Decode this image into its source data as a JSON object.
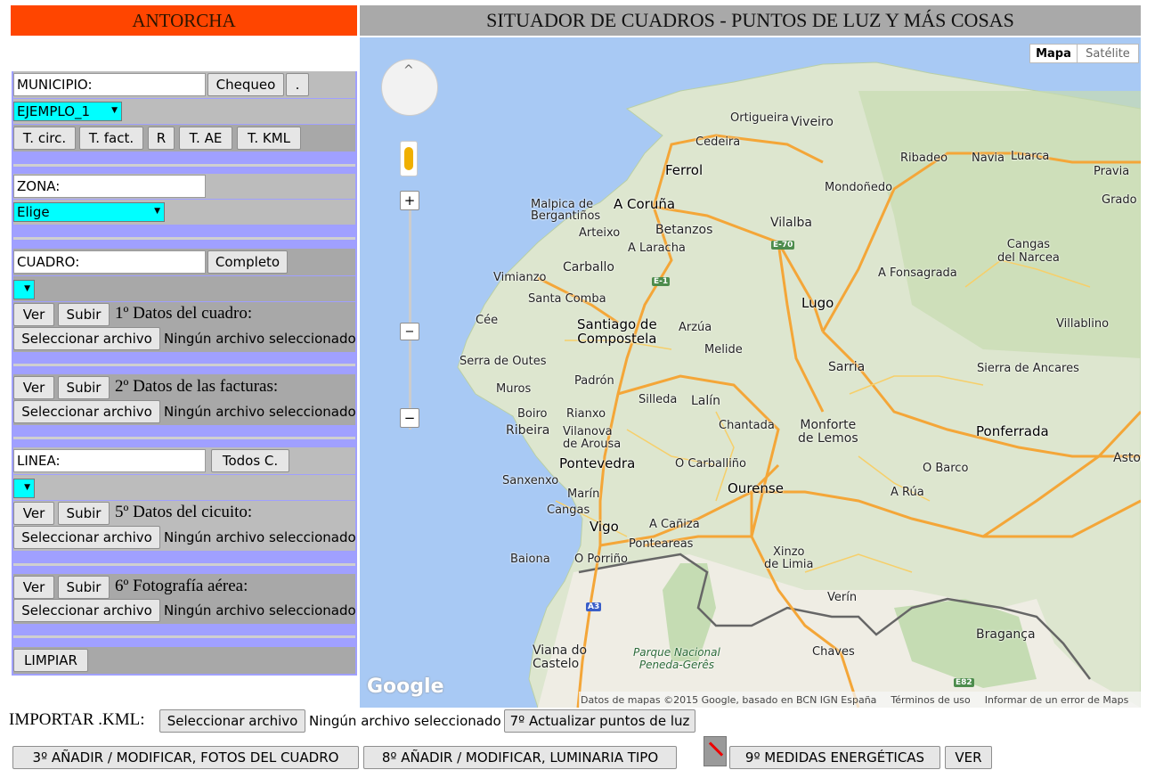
{
  "header": {
    "brand": "ANTORCHA",
    "title": "SITUADOR DE CUADROS - PUNTOS DE LUZ Y MÁS COSAS"
  },
  "colors": {
    "brand_bg": "#ff4500",
    "title_bg": "#a9a9a9",
    "panel_bg": "#a0a0ff",
    "select_bg": "#00ffff",
    "map_water": "#a8c9f4"
  },
  "panel": {
    "municipio": {
      "value": "MUNICIPIO:",
      "check_label": "Chequeo",
      "dot_label": ".",
      "select_value": "EJEMPLO_1"
    },
    "tools": [
      "T. circ.",
      "T. fact.",
      "R",
      "T. AE",
      "T. KML"
    ],
    "zona": {
      "value": "ZONA:",
      "select_value": "Elige"
    },
    "cuadro": {
      "value": "CUADRO:",
      "complete_label": "Completo",
      "select_value": ""
    },
    "file_no_selected": "Ningún archivo seleccionado",
    "file_button": "Seleccionar archivo",
    "ver": "Ver",
    "subir": "Subir",
    "sec1": "1º Datos del cuadro:",
    "sec2": "2º Datos de las facturas:",
    "linea": {
      "value": "LINEA:",
      "all_label": "Todos C.",
      "select_value": ""
    },
    "sec5": "5º Datos del cicuito:",
    "sec6": "6º Fotografía aérea:",
    "clear": "LIMPIAR"
  },
  "map": {
    "type_map": "Mapa",
    "type_sat": "Satélite",
    "logo": "Google",
    "attribution": "Datos de mapas ©2015 Google, basado en BCN IGN España",
    "terms": "Términos de uso",
    "report": "Informar de un error de Maps",
    "zoom_in": "+",
    "zoom_out": "−",
    "zoom_mid": "−",
    "places": {
      "ortigueira": "Ortigueira",
      "viveiro": "Viveiro",
      "cedeira": "Cedeira",
      "ferrol": "Ferrol",
      "ribadeo": "Ribadeo",
      "navia": "Navia",
      "luarca": "Luarca",
      "pravia": "Pravia",
      "grado": "Grado",
      "mondonedo": "Mondoñedo",
      "malpica": "Malpica de\nBergantiños",
      "acoruna": "A Coruña",
      "arteixo": "Arteixo",
      "betanzos": "Betanzos",
      "alaracha": "A Laracha",
      "vilalba": "Vilalba",
      "carballo": "Carballo",
      "cangas_narcea": "Cangas\ndel Narcea",
      "afonsagrada": "A Fonsagrada",
      "vimianzo": "Vimianzo",
      "santacomba": "Santa Comba",
      "lugo": "Lugo",
      "cee": "Cée",
      "santiago": "Santiago de\nCompostela",
      "arzua": "Arzúa",
      "villablino": "Villablino",
      "melide": "Melide",
      "serra": "Serra de Outes",
      "sarria": "Sarria",
      "sierra_ancares": "Sierra de Ancares",
      "muros": "Muros",
      "padron": "Padrón",
      "silleda": "Silleda",
      "lalin": "Lalín",
      "boiro": "Boiro",
      "rianxo": "Rianxo",
      "chantada": "Chantada",
      "monforte": "Monforte\nde Lemos",
      "ponferrada": "Ponferrada",
      "ribeira": "Ribeira",
      "vilanova": "Vilanova\nde Arousa",
      "pontevedra": "Pontevedra",
      "ocarballino": "O Carballiño",
      "obarco": "O Barco",
      "astorga": "Astorg",
      "sanxenxo": "Sanxenxo",
      "ourense": "Ourense",
      "arua": "A Rúa",
      "marin": "Marín",
      "cangas": "Cangas",
      "vigo": "Vigo",
      "acaniza": "A Cañiza",
      "ponteareas": "Ponteareas",
      "baiona": "Baiona",
      "oporrino": "O Porriño",
      "xinzo": "Xinzo\nde Limia",
      "verin": "Verín",
      "braganca": "Bragança",
      "viana": "Viana do\nCastelo",
      "parque": "Parque Nacional\nPeneda-Gerês",
      "chaves": "Chaves"
    },
    "roads": {
      "e70": "E-70",
      "e1": "E-1",
      "a3": "A3",
      "e82": "E82"
    }
  },
  "bottom": {
    "import_label": "IMPORTAR .KML:",
    "import_button": "Seleccionar archivo",
    "import_status": "Ningún archivo seleccionado",
    "update": "7º Actualizar puntos de luz",
    "photos": "3º AÑADIR / MODIFICAR, FOTOS DEL CUADRO",
    "luminaria": "8º AÑADIR / MODIFICAR, LUMINARIA TIPO",
    "medidas": "9º MEDIDAS ENERGÉTICAS",
    "ver": "VER"
  }
}
